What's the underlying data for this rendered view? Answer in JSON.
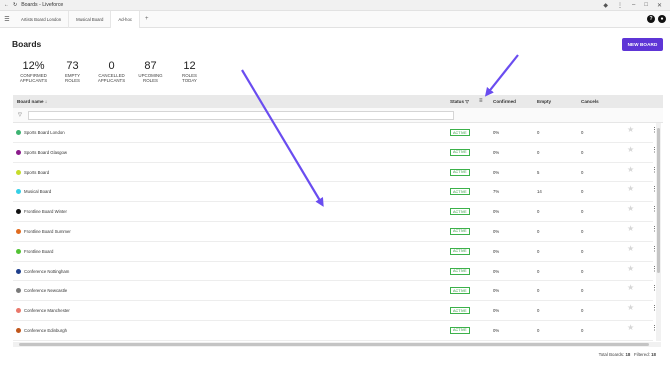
{
  "window": {
    "title": "Boards - Liveforce"
  },
  "tabs": [
    "Artists Board London",
    "Musical Board",
    "Ad-hoc"
  ],
  "page": {
    "title": "Boards",
    "new_board_label": "NEW BOARD"
  },
  "stats": [
    {
      "value": "12%",
      "label1": "CONFIRMED",
      "label2": "APPLICANTS"
    },
    {
      "value": "73",
      "label1": "EMPTY",
      "label2": "ROLES"
    },
    {
      "value": "0",
      "label1": "CANCELLED",
      "label2": "APPLICANTS"
    },
    {
      "value": "87",
      "label1": "UPCOMING",
      "label2": "ROLES"
    },
    {
      "value": "12",
      "label1": "ROLES",
      "label2": "TODAY"
    }
  ],
  "table": {
    "headers": {
      "board_name": "Board name",
      "status": "Status",
      "confirmed": "Confirmed",
      "empty": "Empty",
      "cancels": "Cancels"
    },
    "rows": [
      {
        "name": "Sports Board London",
        "color": "#3cb371",
        "status": "ACTIVE",
        "confirmed": "0%",
        "empty": "0",
        "cancels": "0"
      },
      {
        "name": "Sports Board Glasgow",
        "color": "#8b1a8b",
        "status": "ACTIVE",
        "confirmed": "0%",
        "empty": "0",
        "cancels": "0"
      },
      {
        "name": "Sports Board",
        "color": "#c6dc2a",
        "status": "ACTIVE",
        "confirmed": "0%",
        "empty": "5",
        "cancels": "0"
      },
      {
        "name": "Musical Board",
        "color": "#35cfe6",
        "status": "ACTIVE",
        "confirmed": "7%",
        "empty": "14",
        "cancels": "0"
      },
      {
        "name": "Frontline Board Winter",
        "color": "#111111",
        "status": "ACTIVE",
        "confirmed": "0%",
        "empty": "0",
        "cancels": "0"
      },
      {
        "name": "Frontline Board Summer",
        "color": "#e06b1f",
        "status": "ACTIVE",
        "confirmed": "0%",
        "empty": "0",
        "cancels": "0"
      },
      {
        "name": "Frontline Board",
        "color": "#52c234",
        "status": "ACTIVE",
        "confirmed": "0%",
        "empty": "0",
        "cancels": "0"
      },
      {
        "name": "Conference Nottingham",
        "color": "#1f3f8c",
        "status": "ACTIVE",
        "confirmed": "0%",
        "empty": "0",
        "cancels": "0"
      },
      {
        "name": "Conference Newcastle",
        "color": "#7a7a7a",
        "status": "ACTIVE",
        "confirmed": "0%",
        "empty": "0",
        "cancels": "0"
      },
      {
        "name": "Conference Manchester",
        "color": "#e9776a",
        "status": "ACTIVE",
        "confirmed": "0%",
        "empty": "0",
        "cancels": "0"
      },
      {
        "name": "Conference Edinburgh",
        "color": "#c0561b",
        "status": "ACTIVE",
        "confirmed": "0%",
        "empty": "0",
        "cancels": "0"
      }
    ]
  },
  "footer": {
    "total_label": "Total Boards:",
    "total": "18",
    "filtered_label": "Filtered:",
    "filtered": "18"
  },
  "colors": {
    "accent": "#5e35d6",
    "active_badge": "#3cb14a"
  }
}
